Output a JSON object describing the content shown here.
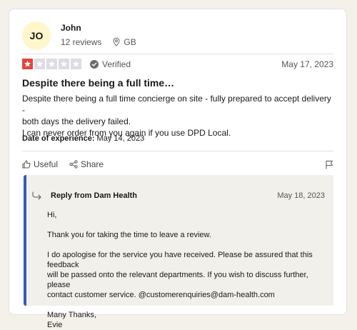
{
  "reviewer": {
    "initials": "JO",
    "name": "John",
    "reviews_count": "12 reviews",
    "country": "GB"
  },
  "review": {
    "rating": 1,
    "max_rating": 5,
    "verified_label": "Verified",
    "date": "May 17, 2023",
    "title": "Despite there being a full time…",
    "body_lines": [
      "Despite there being a full time concierge on site - fully prepared to accept delivery -",
      "both days the delivery failed.",
      "I can never order from you again if you use DPD Local."
    ],
    "experience_label": "Date of experience:",
    "experience_date": "May 14, 2023"
  },
  "actions": {
    "useful_label": "Useful",
    "share_label": "Share"
  },
  "reply": {
    "title": "Reply from Dam Health",
    "date": "May 18, 2023",
    "greeting": "Hi,",
    "para1": "Thank you for taking the time to leave a review.",
    "para2_lines": [
      "I do apologise for the service you have received. Please be assured that this feedback",
      "will be passed onto the relevant departments. If you wish to discuss further, please",
      "contact customer service. @customerenquiries@dam-health.com"
    ],
    "signoff": "Many Thanks,",
    "signature": "Evie"
  },
  "colors": {
    "star_active": "#e5453b",
    "star_inactive": "#dcdce6",
    "reply_accent": "#3c57bc"
  },
  "icons": [
    "location-pin-icon",
    "verified-check-icon",
    "thumbs-up-icon",
    "share-icon",
    "flag-icon",
    "reply-arrow-icon",
    "star-icon"
  ]
}
